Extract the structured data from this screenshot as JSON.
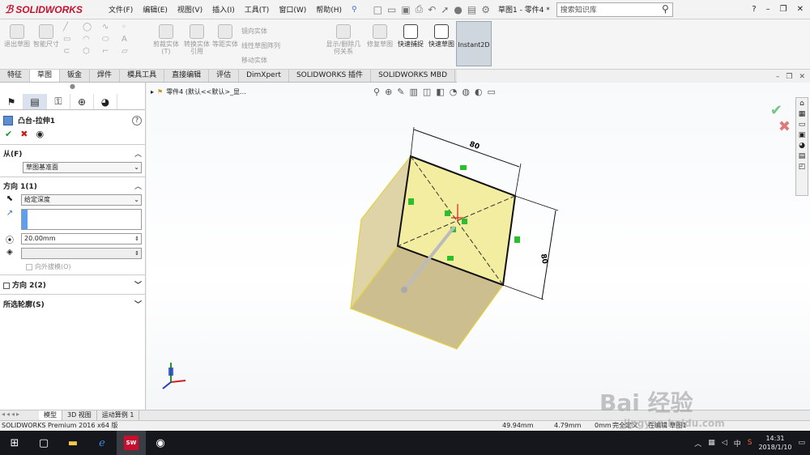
{
  "app": {
    "brand": "SOLIDWORKS",
    "menus": [
      "文件(F)",
      "编辑(E)",
      "视图(V)",
      "插入(I)",
      "工具(T)",
      "窗口(W)",
      "帮助(H)"
    ],
    "doc_title": "草图1 - 零件4 *",
    "search_placeholder": "搜索知识库"
  },
  "ribbon": {
    "items": [
      {
        "label": "退出草图",
        "active": false
      },
      {
        "label": "智能尺寸",
        "active": false
      },
      {
        "label": "剪裁实体(T)",
        "active": false
      },
      {
        "label": "转换实体引用",
        "active": false
      },
      {
        "label": "等距实体",
        "active": false
      },
      {
        "label": "显示/删除几何关系",
        "active": false
      },
      {
        "label": "修复草图",
        "active": false
      },
      {
        "label": "快速捕捉",
        "active": true
      },
      {
        "label": "快速草图",
        "active": true
      },
      {
        "label": "Instant2D",
        "active": true
      }
    ],
    "text_tools": [
      "镜向实体",
      "线性草图阵列",
      "移动实体"
    ]
  },
  "command_tabs": [
    "特征",
    "草图",
    "钣金",
    "焊件",
    "模具工具",
    "直接编辑",
    "评估",
    "DimXpert",
    "SOLIDWORKS 插件",
    "SOLIDWORKS MBD"
  ],
  "active_tab": "草图",
  "feature": {
    "title": "凸台-拉伸1",
    "from_label": "从(F)",
    "from_value": "草图基准面",
    "dir1_label": "方向 1(1)",
    "dir1_type": "给定深度",
    "depth": "20.00mm",
    "draft_label": "向外拔模(O)",
    "dir2_label": "方向 2(2)",
    "contours_label": "所选轮廓(S)"
  },
  "viewport": {
    "tree_label": "零件4  (默认<<默认>_显..."
  },
  "drawing": {
    "dim_top": "80",
    "dim_right": "80"
  },
  "bottom_tabs": [
    "模型",
    "3D 视图",
    "运动算例 1"
  ],
  "status": {
    "product": "SOLIDWORKS Premium 2016 x64 版",
    "x": "49.94mm",
    "y": "4.79mm",
    "z": "0mm",
    "state": "完全定义",
    "edit": "在编辑 草图1"
  },
  "taskbar": {
    "ime": "中",
    "time": "14:31",
    "date": "2018/1/10"
  },
  "watermark": {
    "text": "Bai 经验",
    "url": "jingyan.baidu.com"
  }
}
